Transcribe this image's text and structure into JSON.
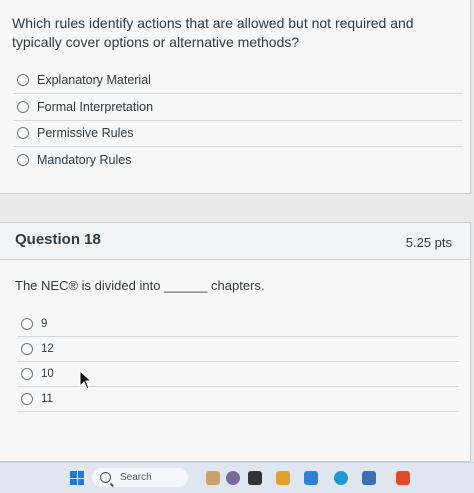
{
  "question1": {
    "text": "Which rules identify actions that are allowed but not required and typically cover options or alternative methods?",
    "answers": [
      "Explanatory Material",
      "Formal Interpretation",
      "Permissive Rules",
      "Mandatory Rules"
    ]
  },
  "question2": {
    "title": "Question 18",
    "points": "5.25 pts",
    "text": "The NEC® is divided into ______ chapters.",
    "answers": [
      "9",
      "12",
      "10",
      "11"
    ]
  },
  "taskbar": {
    "search_label": "Search"
  },
  "colors": {
    "taskbar_bg": "#dfe6ef",
    "text": "#2d3b45",
    "windows_blue": "#1e79d6"
  }
}
